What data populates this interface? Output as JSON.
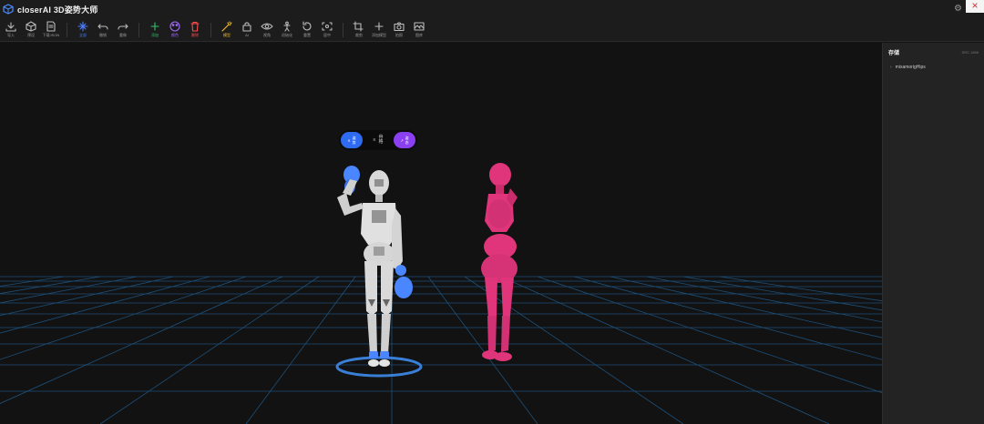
{
  "app": {
    "title": "closerAI 3D姿势大师",
    "close_icon": "×",
    "settings_icon": "⚙"
  },
  "toolbar": {
    "items": [
      {
        "label": "导入",
        "icon": "import-icon",
        "color": "#bbbbbb"
      },
      {
        "label": "预设",
        "icon": "preset-icon",
        "color": "#bbbbbb"
      },
      {
        "label": "下载JSON",
        "icon": "file-icon",
        "color": "#bbbbbb"
      },
      {
        "label": "全部",
        "icon": "select-icon",
        "color": "#4a7dff"
      },
      {
        "label": "撤销",
        "icon": "undo-icon",
        "color": "#bbbbbb"
      },
      {
        "label": "重做",
        "icon": "redo-icon",
        "color": "#bbbbbb"
      },
      {
        "label": "添加",
        "icon": "add-icon",
        "color": "#31c46b"
      },
      {
        "label": "颜色",
        "icon": "palette-icon",
        "color": "#a46bff"
      },
      {
        "label": "删除",
        "icon": "delete-icon",
        "color": "#ff4d4d"
      },
      {
        "label": "模型",
        "icon": "magic-icon",
        "color": "#f0c030"
      },
      {
        "label": "AI",
        "icon": "lock-icon",
        "color": "#bbbbbb"
      },
      {
        "label": "视角",
        "icon": "eye-icon",
        "color": "#bbbbbb"
      },
      {
        "label": "初始化",
        "icon": "figure-icon",
        "color": "#bbbbbb"
      },
      {
        "label": "重置",
        "icon": "reset-icon",
        "color": "#bbbbbb"
      },
      {
        "label": "居中",
        "icon": "center-icon",
        "color": "#bbbbbb"
      },
      {
        "label": "裁剪",
        "icon": "crop-icon",
        "color": "#bbbbbb"
      },
      {
        "label": "添加模型",
        "icon": "plus-icon",
        "color": "#bbbbbb"
      },
      {
        "label": "拍照",
        "icon": "camera-icon",
        "color": "#bbbbbb"
      },
      {
        "label": "图库",
        "icon": "gallery-icon",
        "color": "#bbbbbb"
      }
    ]
  },
  "float_toolbar": {
    "left_label_1": "姿",
    "left_label_2": "势",
    "mid_label_1": "骨",
    "mid_label_2": "格",
    "right_label_1": "姿",
    "right_label_2": "态"
  },
  "panel": {
    "title": "存储",
    "meta": "SRC 1896",
    "tree": [
      {
        "label": "mixamorigHips"
      }
    ]
  },
  "colors": {
    "accent_blue": "#2f6bf0",
    "accent_purple": "#8a3ff0",
    "grid": "#1f5a8a",
    "mannequin_white": "#d8d8d8",
    "mannequin_pink": "#e0357a",
    "joint_blue": "#4a86ff"
  }
}
